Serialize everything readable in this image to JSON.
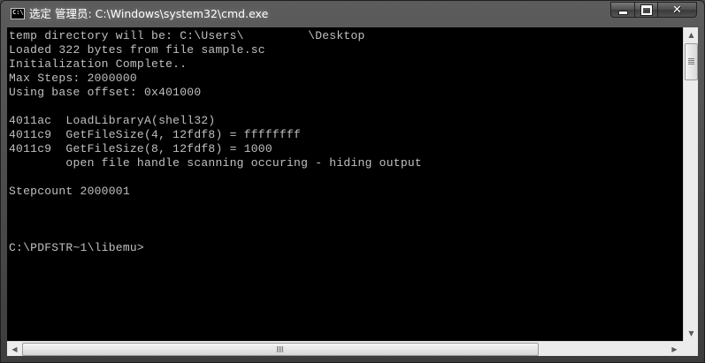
{
  "window": {
    "title": "选定 管理员: C:\\Windows\\system32\\cmd.exe",
    "app_icon": "cmd-icon",
    "buttons": {
      "minimize": "minimize-icon",
      "maximize": "maximize-icon",
      "close": "close-icon"
    }
  },
  "console": {
    "lines": [
      "temp directory will be: C:\\Users\\         \\Desktop",
      "Loaded 322 bytes from file sample.sc",
      "Initialization Complete..",
      "Max Steps: 2000000",
      "Using base offset: 0x401000",
      "",
      "4011ac  LoadLibraryA(shell32)",
      "4011c9  GetFileSize(4, 12fdf8) = ffffffff",
      "4011c9  GetFileSize(8, 12fdf8) = 1000",
      "        open file handle scanning occuring - hiding output",
      "",
      "Stepcount 2000001",
      "",
      "",
      "",
      "C:\\PDFSTR~1\\libemu>"
    ],
    "text_color": "#c0c0c0",
    "background_color": "#000000"
  },
  "scrollbars": {
    "vertical": {
      "up_icon": "arrow-up-icon",
      "down_icon": "arrow-down-icon"
    },
    "horizontal": {
      "left_icon": "arrow-left-icon",
      "right_icon": "arrow-right-icon"
    }
  }
}
